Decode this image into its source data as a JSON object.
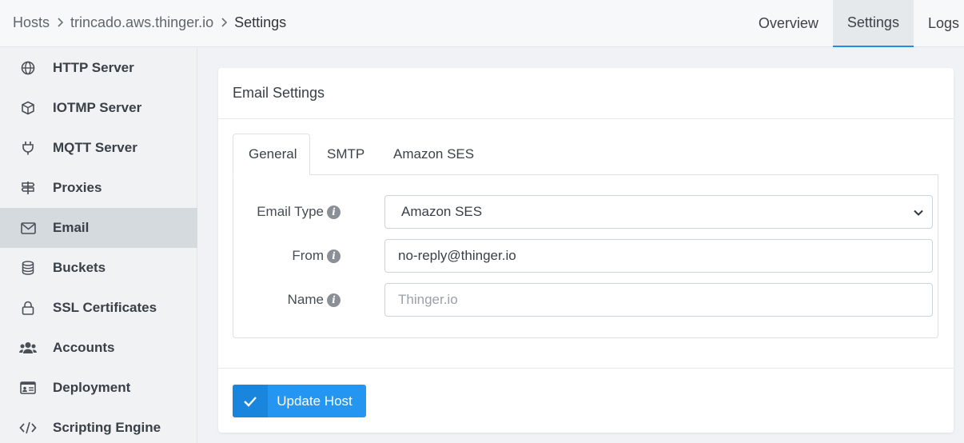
{
  "breadcrumb": {
    "root": "Hosts",
    "host": "trincado.aws.thinger.io",
    "current": "Settings"
  },
  "top_tabs": [
    {
      "label": "Overview",
      "active": false
    },
    {
      "label": "Settings",
      "active": true
    },
    {
      "label": "Logs",
      "active": false
    }
  ],
  "sidebar": {
    "items": [
      {
        "label": "HTTP Server",
        "icon": "globe-icon"
      },
      {
        "label": "IOTMP Server",
        "icon": "cube-icon"
      },
      {
        "label": "MQTT Server",
        "icon": "plug-icon"
      },
      {
        "label": "Proxies",
        "icon": "signpost-icon"
      },
      {
        "label": "Email",
        "icon": "envelope-icon",
        "active": true
      },
      {
        "label": "Buckets",
        "icon": "database-icon"
      },
      {
        "label": "SSL Certificates",
        "icon": "lock-icon"
      },
      {
        "label": "Accounts",
        "icon": "users-icon"
      },
      {
        "label": "Deployment",
        "icon": "id-card-icon"
      },
      {
        "label": "Scripting Engine",
        "icon": "code-icon"
      }
    ]
  },
  "card": {
    "title": "Email Settings",
    "tabs": [
      {
        "label": "General",
        "active": true
      },
      {
        "label": "SMTP",
        "active": false
      },
      {
        "label": "Amazon SES",
        "active": false
      }
    ],
    "fields": {
      "email_type": {
        "label": "Email Type",
        "value": "Amazon SES"
      },
      "from": {
        "label": "From",
        "value": "no-reply@thinger.io"
      },
      "name": {
        "label": "Name",
        "value": "",
        "placeholder": "Thinger.io"
      }
    },
    "submit_label": "Update Host"
  },
  "colors": {
    "accent": "#2496f1",
    "accent_dark": "#1a85dc",
    "active_sidebar": "#d5dade"
  }
}
